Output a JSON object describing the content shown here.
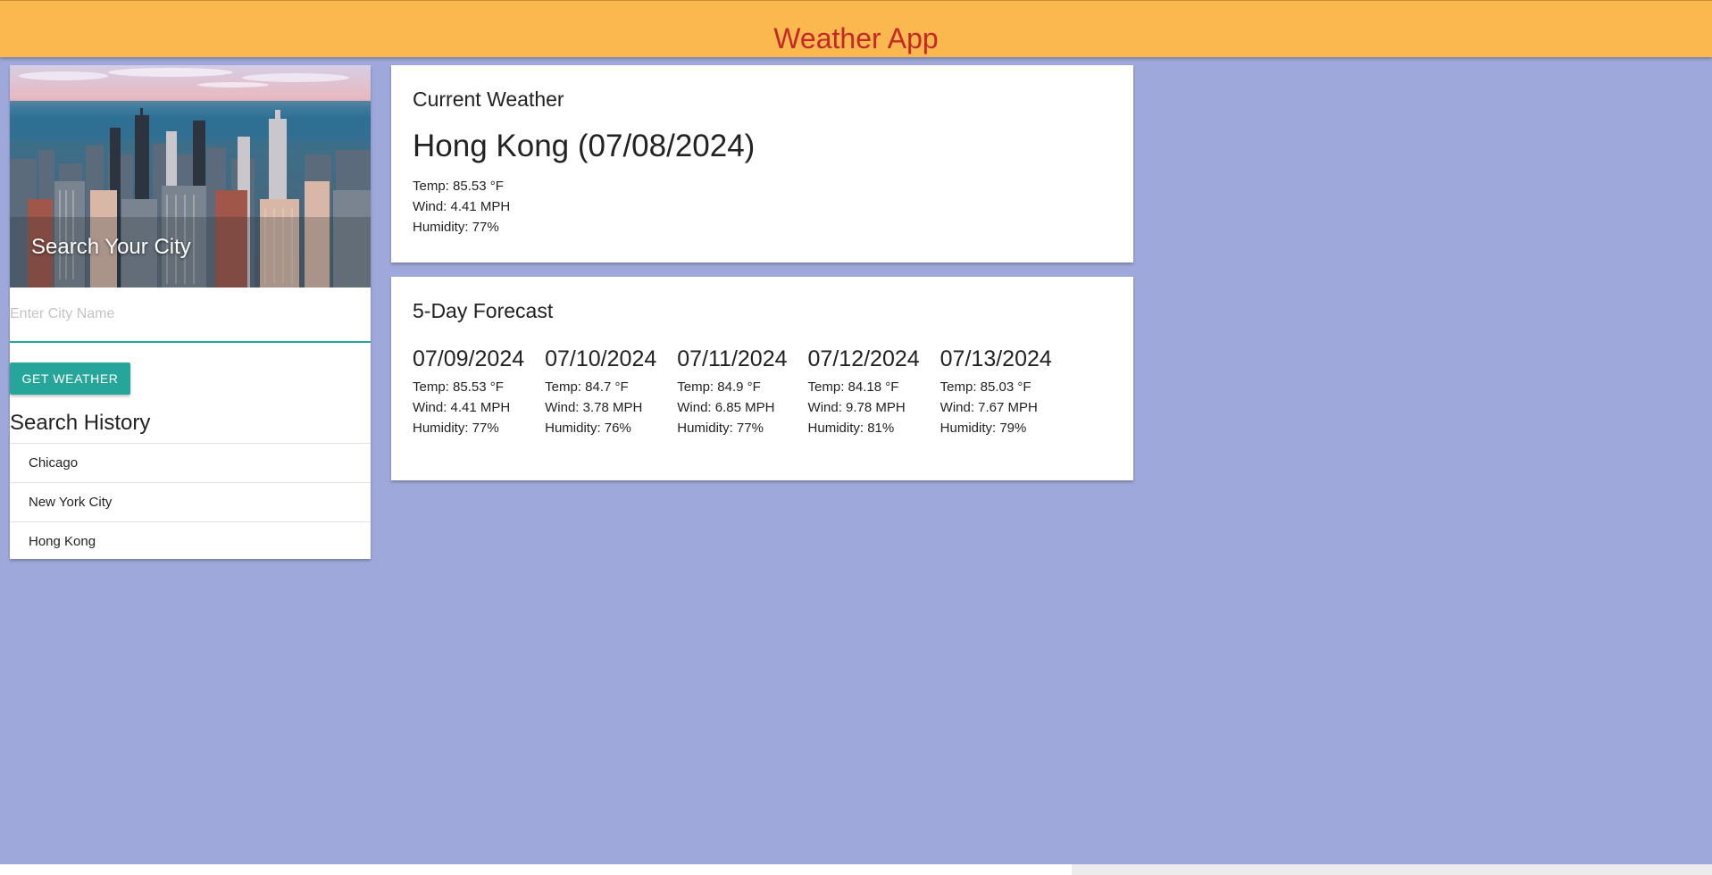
{
  "app_title": "Weather App",
  "search": {
    "hero_title": "Search Your City",
    "placeholder": "Enter City Name",
    "value": "",
    "button_label": "GET WEATHER"
  },
  "history": {
    "title": "Search History",
    "items": [
      "Chicago",
      "New York City",
      "Hong Kong"
    ]
  },
  "current": {
    "section_title": "Current Weather",
    "heading": "Hong Kong (07/08/2024)",
    "temp": "Temp: 85.53 °F",
    "wind": "Wind: 4.41 MPH",
    "humidity": "Humidity: 77%"
  },
  "forecast": {
    "section_title": "5-Day Forecast",
    "days": [
      {
        "date": "07/09/2024",
        "temp": "Temp: 85.53 °F",
        "wind": "Wind: 4.41 MPH",
        "humidity": "Humidity: 77%"
      },
      {
        "date": "07/10/2024",
        "temp": "Temp: 84.7 °F",
        "wind": "Wind: 3.78 MPH",
        "humidity": "Humidity: 76%"
      },
      {
        "date": "07/11/2024",
        "temp": "Temp: 84.9 °F",
        "wind": "Wind: 6.85 MPH",
        "humidity": "Humidity: 77%"
      },
      {
        "date": "07/12/2024",
        "temp": "Temp: 84.18 °F",
        "wind": "Wind: 9.78 MPH",
        "humidity": "Humidity: 81%"
      },
      {
        "date": "07/13/2024",
        "temp": "Temp: 85.03 °F",
        "wind": "Wind: 7.67 MPH",
        "humidity": "Humidity: 79%"
      }
    ]
  },
  "colors": {
    "header_bg": "#fbb84f",
    "title_color": "#c62828",
    "page_bg": "#9fa8da",
    "accent": "#26a69a"
  }
}
